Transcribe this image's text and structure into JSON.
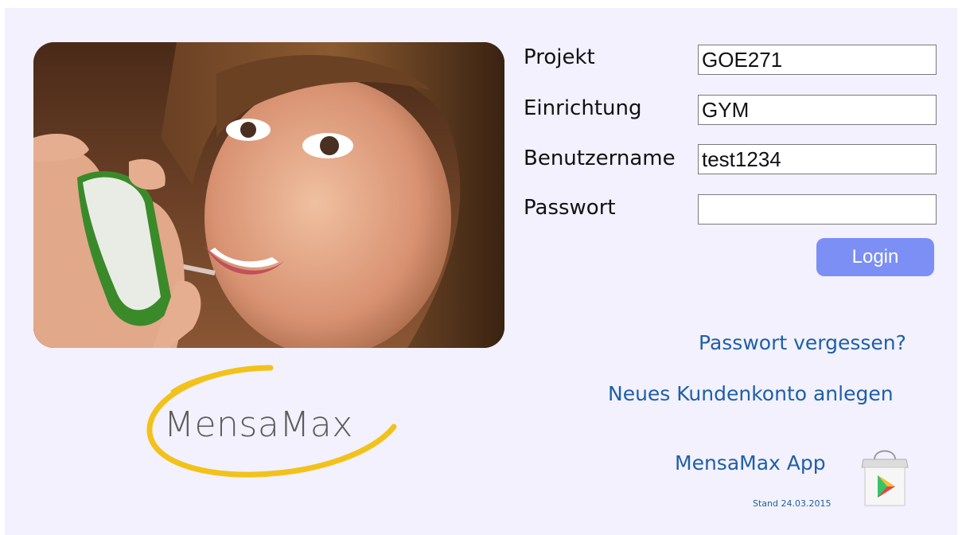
{
  "form": {
    "projekt": {
      "label": "Projekt",
      "value": "GOE271"
    },
    "einrichtung": {
      "label": "Einrichtung",
      "value": "GYM"
    },
    "benutzername": {
      "label": "Benutzername",
      "value": "test1234"
    },
    "passwort": {
      "label": "Passwort",
      "value": ""
    },
    "login_label": "Login"
  },
  "links": {
    "forgot_password": "Passwort vergessen?",
    "new_account": "Neues Kundenkonto anlegen",
    "app": "MensaMax App"
  },
  "footer": {
    "stand": "Stand 24.03.2015"
  },
  "logo": {
    "text": "MensaMax"
  },
  "icons": {
    "store": "google-play-store-icon"
  },
  "colors": {
    "background": "#f2f1fd",
    "link": "#1f5fa8",
    "button": "#7c8ff5",
    "logo_swoosh": "#f2c21a"
  }
}
